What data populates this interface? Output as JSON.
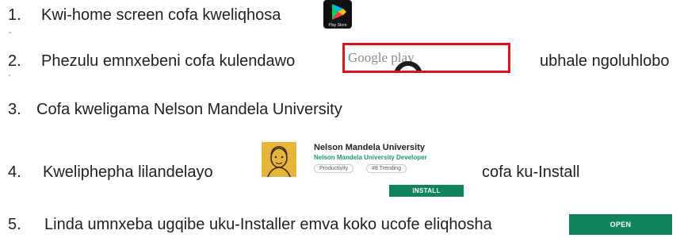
{
  "steps": [
    {
      "num": "1.",
      "text": "Kwi-home screen cofa kweliqhosa"
    },
    {
      "num": "2.",
      "text": "Phezulu emnxebeni cofa kulendawo",
      "after": "ubhale ngoluhlobo"
    },
    {
      "num": "3.",
      "text": "Cofa kweligama Nelson Mandela University"
    },
    {
      "num": "4.",
      "text": "Kweliphepha lilandelayo",
      "after": "cofa ku-Install"
    },
    {
      "num": "5.",
      "text": "Linda umnxeba ugqibe uku-Installer emva koko ucofe eliqhosha"
    }
  ],
  "play_store": {
    "icon": "play-store-icon",
    "label": "Play Store"
  },
  "search": {
    "placeholder": "Google play"
  },
  "app": {
    "title": "Nelson Mandela University",
    "developer": "Nelson Mandela University Developer",
    "chips": [
      "Productivity",
      "#8 Trending"
    ],
    "install_label": "INSTALL",
    "thumb_icon": "mandela-portrait-icon"
  },
  "open_label": "OPEN",
  "colors": {
    "accent_green": "#10845c",
    "highlight_red": "#e0121b",
    "developer_green": "#1a9b63"
  }
}
